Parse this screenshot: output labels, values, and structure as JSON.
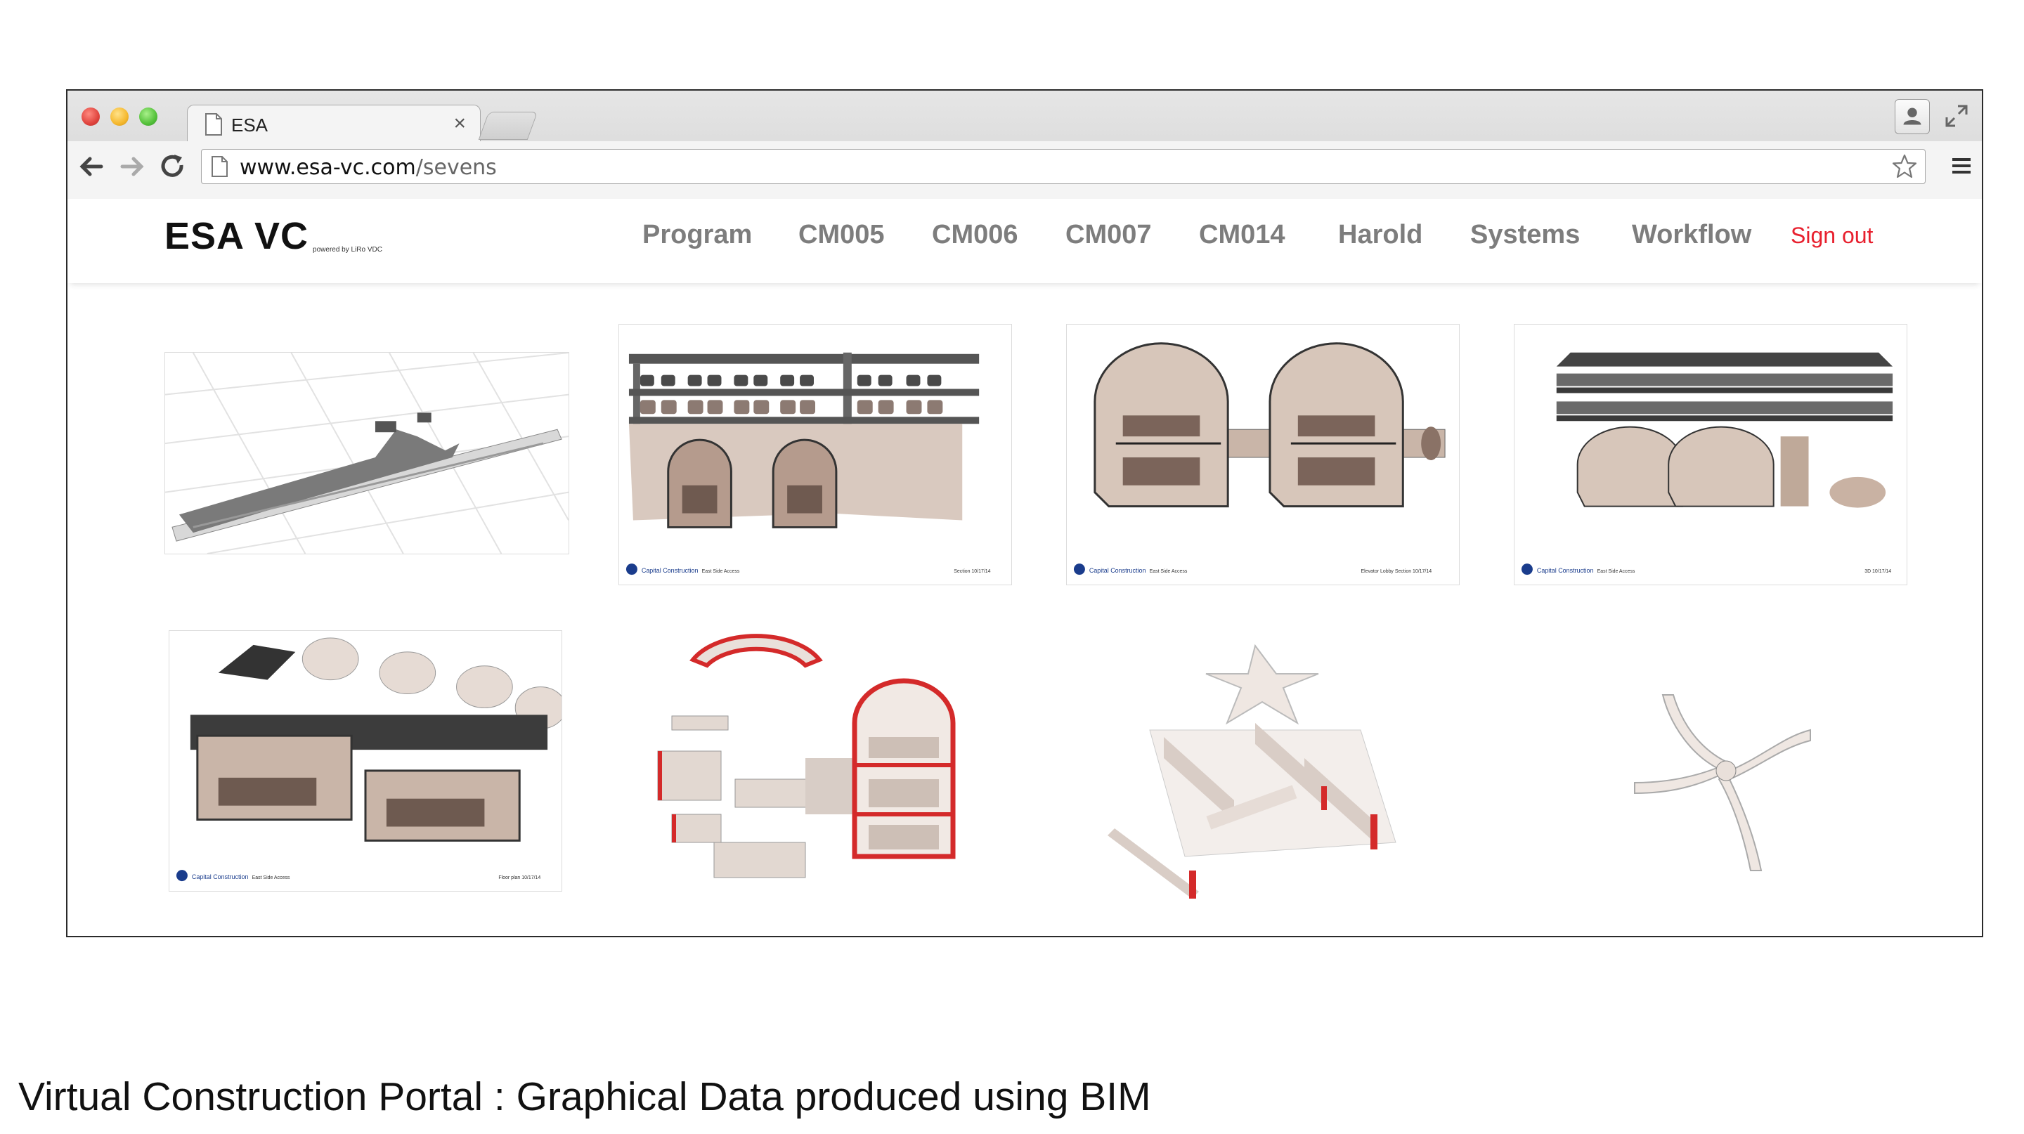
{
  "browser": {
    "tab_title": "ESA",
    "tab_close": "×",
    "url_host": "www.esa-vc.com",
    "url_path": "/sevens"
  },
  "site": {
    "logo": "ESA VC",
    "logo_sub": "powered by LiRo VDC",
    "nav": [
      "Program",
      "CM005",
      "CM006",
      "CM007",
      "CM014",
      "Harold",
      "Systems",
      "Workflow"
    ],
    "sign_out": "Sign out"
  },
  "gallery": {
    "thumbnails": [
      {
        "name": "site-plan-drawing",
        "footer": ""
      },
      {
        "name": "section-drawing",
        "footer_brand": "Capital Construction",
        "footer_project": "East Side Access",
        "footer_date": "Section  10/17/14"
      },
      {
        "name": "elevator-lobby-section",
        "footer_brand": "Capital Construction",
        "footer_project": "East Side Access",
        "footer_date": "Elevator Lobby Section  10/17/14"
      },
      {
        "name": "3d-model-view",
        "footer_brand": "Capital Construction",
        "footer_project": "East Side Access",
        "footer_date": "3D  10/17/14"
      },
      {
        "name": "floor-plan-drawing",
        "footer_brand": "Capital Construction",
        "footer_project": "East Side Access",
        "footer_date": "Floor plan  10/17/14"
      },
      {
        "name": "exploded-cavern-model"
      },
      {
        "name": "exploded-structure-model"
      },
      {
        "name": "cross-bracing-model"
      }
    ]
  },
  "caption": "Virtual Construction Portal : Graphical Data produced using BIM",
  "colors": {
    "nav_text": "#7d7d7d",
    "sign_out": "#e8202e",
    "accent_red": "#d42a2a"
  }
}
